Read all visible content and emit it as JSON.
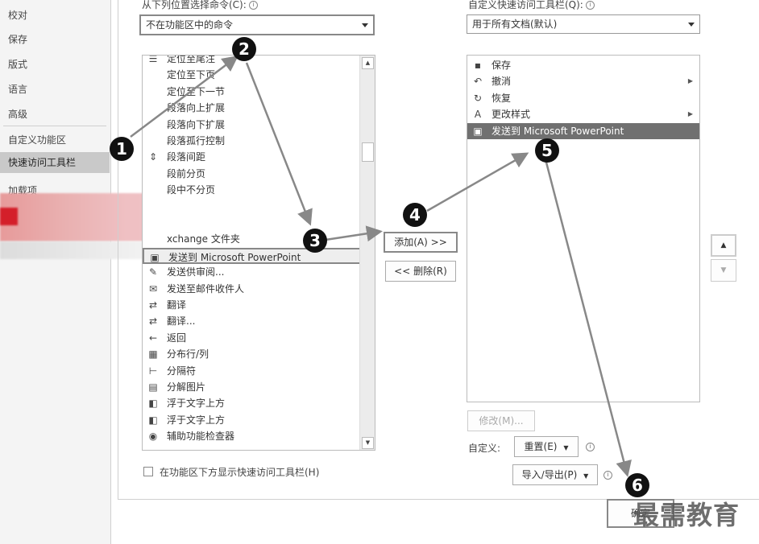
{
  "nav": {
    "items": [
      "校对",
      "保存",
      "版式",
      "语言",
      "高级",
      "自定义功能区",
      "快速访问工具栏",
      "加载项"
    ],
    "selected_index": 6
  },
  "left_panel": {
    "choose_label": "从下列位置选择命令(C):",
    "choose_value": "不在功能区中的命令",
    "commands": [
      {
        "label": "定位至尾注",
        "icon": "list-icon"
      },
      {
        "label": "定位至下页",
        "icon": ""
      },
      {
        "label": "定位至下一节",
        "icon": ""
      },
      {
        "label": "段落向上扩展",
        "icon": ""
      },
      {
        "label": "段落向下扩展",
        "icon": ""
      },
      {
        "label": "段落孤行控制",
        "icon": ""
      },
      {
        "label": "段落间距",
        "icon": "spacing-icon",
        "submenu": true
      },
      {
        "label": "段前分页",
        "icon": ""
      },
      {
        "label": "段中不分页",
        "icon": ""
      },
      {
        "label": "",
        "icon": ""
      },
      {
        "label": "",
        "icon": ""
      },
      {
        "label": "xchange 文件夹",
        "icon": ""
      },
      {
        "label": "发送到 Microsoft PowerPoint",
        "icon": "send-ppt-icon",
        "selected": true
      },
      {
        "label": "发送供审阅...",
        "icon": "review-icon"
      },
      {
        "label": "发送至邮件收件人",
        "icon": "mail-icon"
      },
      {
        "label": "翻译",
        "icon": "translate-icon"
      },
      {
        "label": "翻译...",
        "icon": "translate-icon"
      },
      {
        "label": "返回",
        "icon": "back-arrow-icon"
      },
      {
        "label": "分布行/列",
        "icon": "grid-icon"
      },
      {
        "label": "分隔符",
        "icon": "separator-icon"
      },
      {
        "label": "分解图片",
        "icon": "picture-icon"
      },
      {
        "label": "浮于文字上方",
        "icon": "float-icon"
      },
      {
        "label": "浮于文字上方",
        "icon": "float-icon"
      },
      {
        "label": "辅助功能检查器",
        "icon": "accessibility-icon"
      }
    ],
    "show_below_ribbon": "在功能区下方显示快速访问工具栏(H)"
  },
  "middle": {
    "add_label": "添加(A) >>",
    "remove_label": "<< 删除(R)"
  },
  "right_panel": {
    "customize_label": "自定义快速访问工具栏(Q):",
    "customize_value": "用于所有文档(默认)",
    "items": [
      {
        "label": "保存",
        "icon": "save-icon"
      },
      {
        "label": "撤消",
        "icon": "undo-icon",
        "submenu": true
      },
      {
        "label": "恢复",
        "icon": "redo-icon"
      },
      {
        "label": "更改样式",
        "icon": "styles-icon",
        "submenu": true
      },
      {
        "label": "发送到 Microsoft PowerPoint",
        "icon": "send-ppt-icon",
        "selected": true
      }
    ],
    "modify_label": "修改(M)...",
    "custom_label": "自定义:",
    "reset_label": "重置(E)",
    "import_export_label": "导入/导出(P)"
  },
  "steps": [
    "1",
    "2",
    "3",
    "4",
    "5",
    "6"
  ],
  "ok_button_label": "确定",
  "watermark": "最需教育",
  "colors": {
    "highlight": "#707070",
    "selected_nav": "#c9c9c9",
    "annotation": "#111111"
  }
}
